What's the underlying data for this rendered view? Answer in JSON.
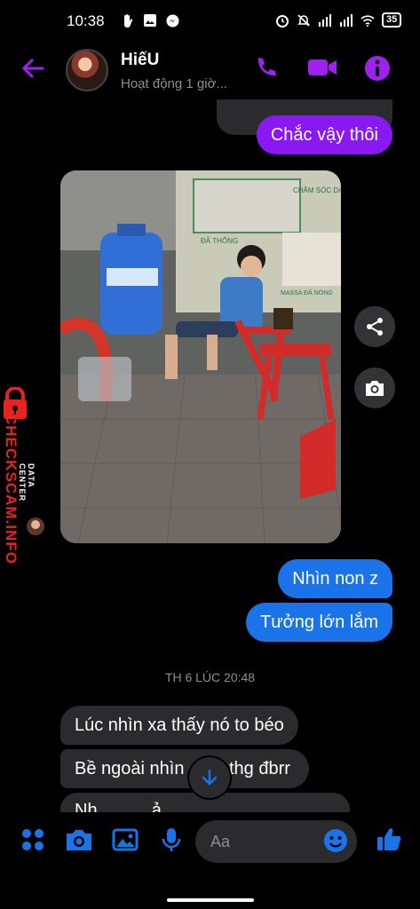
{
  "status_bar": {
    "time": "10:38",
    "battery": "35"
  },
  "header": {
    "name": "HiếU",
    "status": "Hoạt động 1 giờ..."
  },
  "messages": {
    "out1": "Chắc vậy thôi",
    "out2": "Nhìn non z",
    "out3": "Tưởng lớn lắm",
    "timestamp": "TH 6 LÚC 20:48",
    "in1": "Lúc nhìn xa thấy nó to béo",
    "in2": "Bề ngoài nhìn",
    "in2_tail": "thg đbrr",
    "in3": "Nh... ... ...ả ... ... ..."
  },
  "photo": {
    "signboard_1": "CHĂM SÓC DA",
    "signboard_2": "ĐÃ THÔNG",
    "signboard_3": "MASSA ĐÁ NÓNG"
  },
  "watermark": {
    "line1": "DATA CENTER",
    "line2": "CHECKSCAM.INFO"
  },
  "composer": {
    "placeholder": "Aa"
  },
  "colors": {
    "accent_purple": "#8a18f0",
    "accent_blue": "#1a73e8",
    "header_icons": "#a020f0",
    "composer_icons": "#1a73e8"
  }
}
